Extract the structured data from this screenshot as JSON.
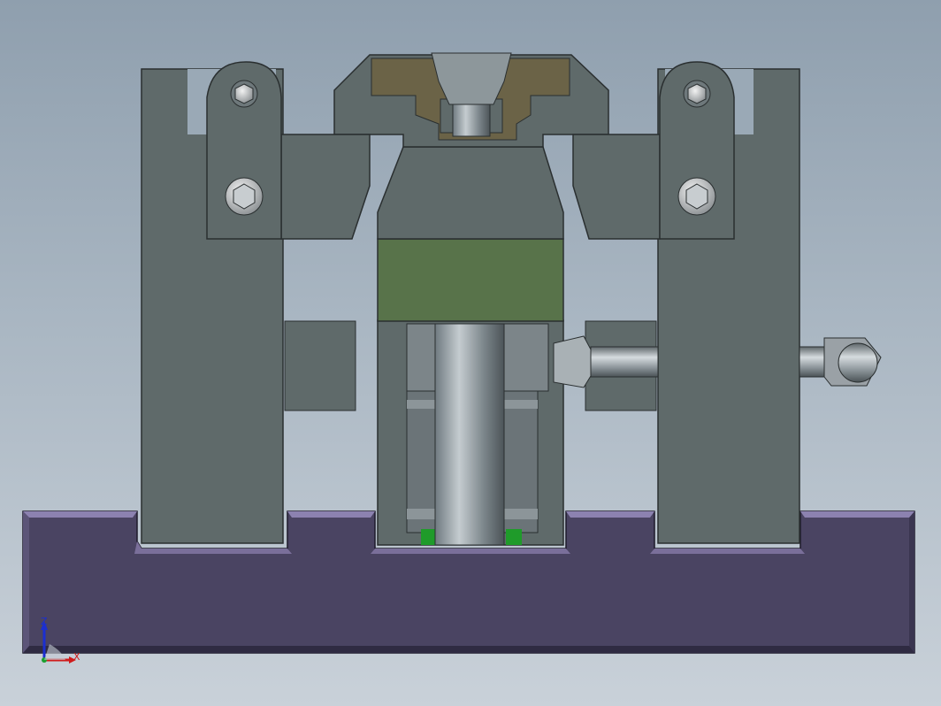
{
  "view": {
    "background_top": "#8f9fae",
    "background_bottom": "#c9d1d9"
  },
  "parts": {
    "base_plate": {
      "color": "#4a4462",
      "edge": "#7a6f9a"
    },
    "clamp_arms": {
      "color": "#5f6a6a",
      "edge": "#2a2f30"
    },
    "top_jaw_insert": {
      "color": "#6b6347"
    },
    "cylinder_collar": {
      "color": "#58734a"
    },
    "fittings": {
      "color": "#9aa1a6"
    },
    "fastener_icons": [
      "hex-socket-bolt-icon",
      "hex-socket-bolt-icon",
      "hex-socket-bolt-icon",
      "hex-socket-bolt-icon"
    ]
  },
  "triad": {
    "z_label": "Z",
    "x_label": "X",
    "z_color": "#1b2fd0",
    "x_color": "#d01b1b",
    "y_color": "#1ba02f"
  }
}
